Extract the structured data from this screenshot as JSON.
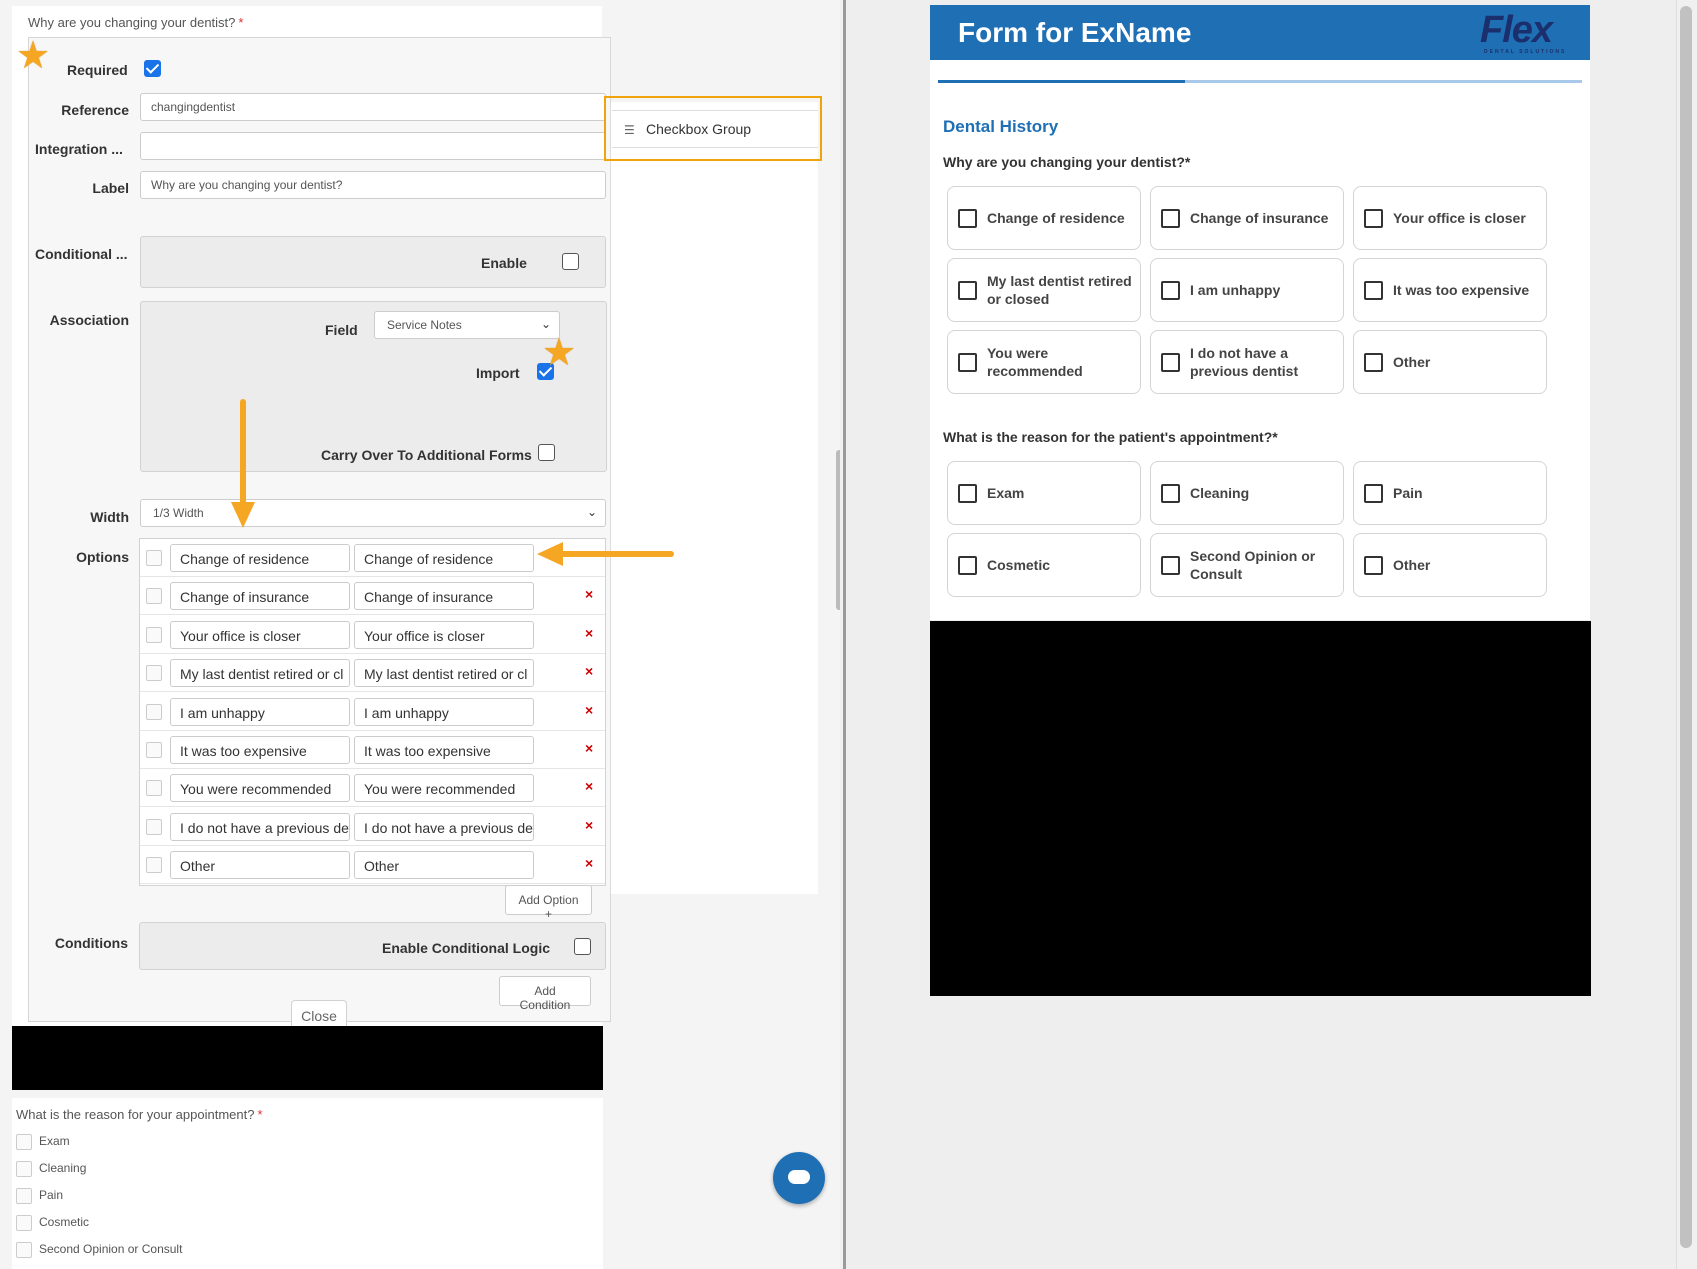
{
  "editor": {
    "question_title": "Why are you changing your dentist?",
    "required_marker": "*",
    "required_label": "Required",
    "reference_label": "Reference",
    "reference_value": "changingdentist",
    "integration_label": "Integration ...",
    "integration_value": "",
    "label_label": "Label",
    "label_value": "Why are you changing your dentist?",
    "conditional_label": "Conditional ...",
    "enable_label": "Enable",
    "association_label": "Association",
    "field_label": "Field",
    "field_value": "Service Notes",
    "import_label": "Import",
    "carry_over_label": "Carry Over To Additional Forms",
    "width_label": "Width",
    "width_value": "1/3 Width",
    "options_label": "Options",
    "options": [
      {
        "value": "Change of residence",
        "label": "Change of residence"
      },
      {
        "value": "Change of insurance",
        "label": "Change of insurance"
      },
      {
        "value": "Your office is closer",
        "label": "Your office is closer"
      },
      {
        "value": "My last dentist retired or cl",
        "label": "My last dentist retired or cl"
      },
      {
        "value": "I am unhappy",
        "label": "I am unhappy"
      },
      {
        "value": "It was too expensive",
        "label": "It was too expensive"
      },
      {
        "value": "You were recommended",
        "label": "You were recommended"
      },
      {
        "value": "I do not have a previous de",
        "label": "I do not have a previous de"
      },
      {
        "value": "Other",
        "label": "Other"
      }
    ],
    "delete_symbol": "×",
    "add_option_label": "Add Option +",
    "conditions_label": "Conditions",
    "enable_logic_label": "Enable Conditional Logic",
    "add_condition_label": "Add Condition",
    "close_label": "Close",
    "required_checked": true,
    "import_checked": true
  },
  "appointment_preview": {
    "title": "What is the reason for your appointment?",
    "required_marker": "*",
    "items": [
      "Exam",
      "Cleaning",
      "Pain",
      "Cosmetic",
      "Second Opinion or Consult"
    ]
  },
  "palette": {
    "item_label": "Checkbox Group",
    "item_icon": "list-icon"
  },
  "form_preview": {
    "title": "Form for ExName",
    "brand": "Flex",
    "brand_sub": "DENTAL SOLUTIONS",
    "section_title": "Dental History",
    "question1": "Why are you changing your dentist?",
    "question1_marker": "*",
    "question1_options": [
      "Change of residence",
      "Change of insurance",
      "Your office is closer",
      "My last dentist retired or closed",
      "I am unhappy",
      "It was too expensive",
      "You were recommended",
      "I do not have a previous dentist",
      "Other"
    ],
    "question2": "What is the reason for the patient's appointment?",
    "question2_marker": "*",
    "question2_options": [
      "Exam",
      "Cleaning",
      "Pain",
      "Cosmetic",
      "Second Opinion or Consult",
      "Other"
    ]
  },
  "colors": {
    "brand_blue": "#1f6fb5",
    "annotation_orange": "#f5a623",
    "delete_red": "#cc0000"
  }
}
